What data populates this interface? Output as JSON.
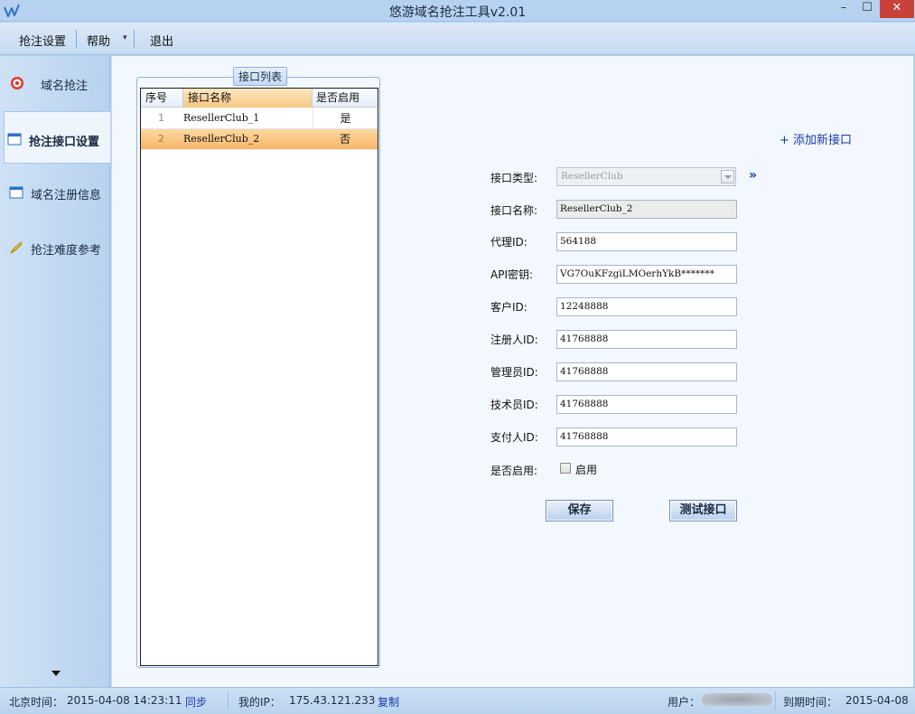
{
  "window": {
    "title": "悠游域名抢注工具v2.01",
    "min": "–",
    "max": "☐",
    "close": "✕"
  },
  "menu": {
    "settings": "抢注设置",
    "help": "帮助",
    "exit": "退出"
  },
  "nav": [
    {
      "label": "域名抢注",
      "icon": "target-icon"
    },
    {
      "label": "抢注接口设置",
      "icon": "window-icon",
      "active": true
    },
    {
      "label": "域名注册信息",
      "icon": "window-icon"
    },
    {
      "label": "抢注难度参考",
      "icon": "pen-icon"
    }
  ],
  "list": {
    "title": "接口列表",
    "columns": [
      "序号",
      "接口名称",
      "是否启用"
    ],
    "rows": [
      {
        "no": "1",
        "name": "ResellerClub_1",
        "enabled": "是"
      },
      {
        "no": "2",
        "name": "ResellerClub_2",
        "enabled": "否"
      }
    ]
  },
  "form": {
    "add_link": "+ 添加新接口",
    "type_label": "接口类型:",
    "type_value": "ResellerClub",
    "expand": "»",
    "name_label": "接口名称:",
    "name_value": "ResellerClub_2",
    "agent_label": "代理ID:",
    "agent_value": "564188",
    "api_label": "API密钥:",
    "api_value": "VG7OuKFzgiLMOerhYkB*******",
    "customer_label": "客户ID:",
    "customer_value": "12248888",
    "registrant_label": "注册人ID:",
    "registrant_value": "41768888",
    "admin_label": "管理员ID:",
    "admin_value": "41768888",
    "tech_label": "技术员ID:",
    "tech_value": "41768888",
    "billing_label": "支付人ID:",
    "billing_value": "41768888",
    "enabled_label": "是否启用:",
    "enabled_checkbox": "启用",
    "save": "保存",
    "test": "测试接口"
  },
  "status": {
    "beijing_time_label": "北京时间：",
    "beijing_time": "2015-04-08 14:23:11",
    "sync": "同步",
    "ip_label": "我的IP：",
    "ip": "175.43.121.233",
    "copy": "复制",
    "user_label": "用户：",
    "expire_label": "到期时间：",
    "expire": "2015-04-08"
  }
}
